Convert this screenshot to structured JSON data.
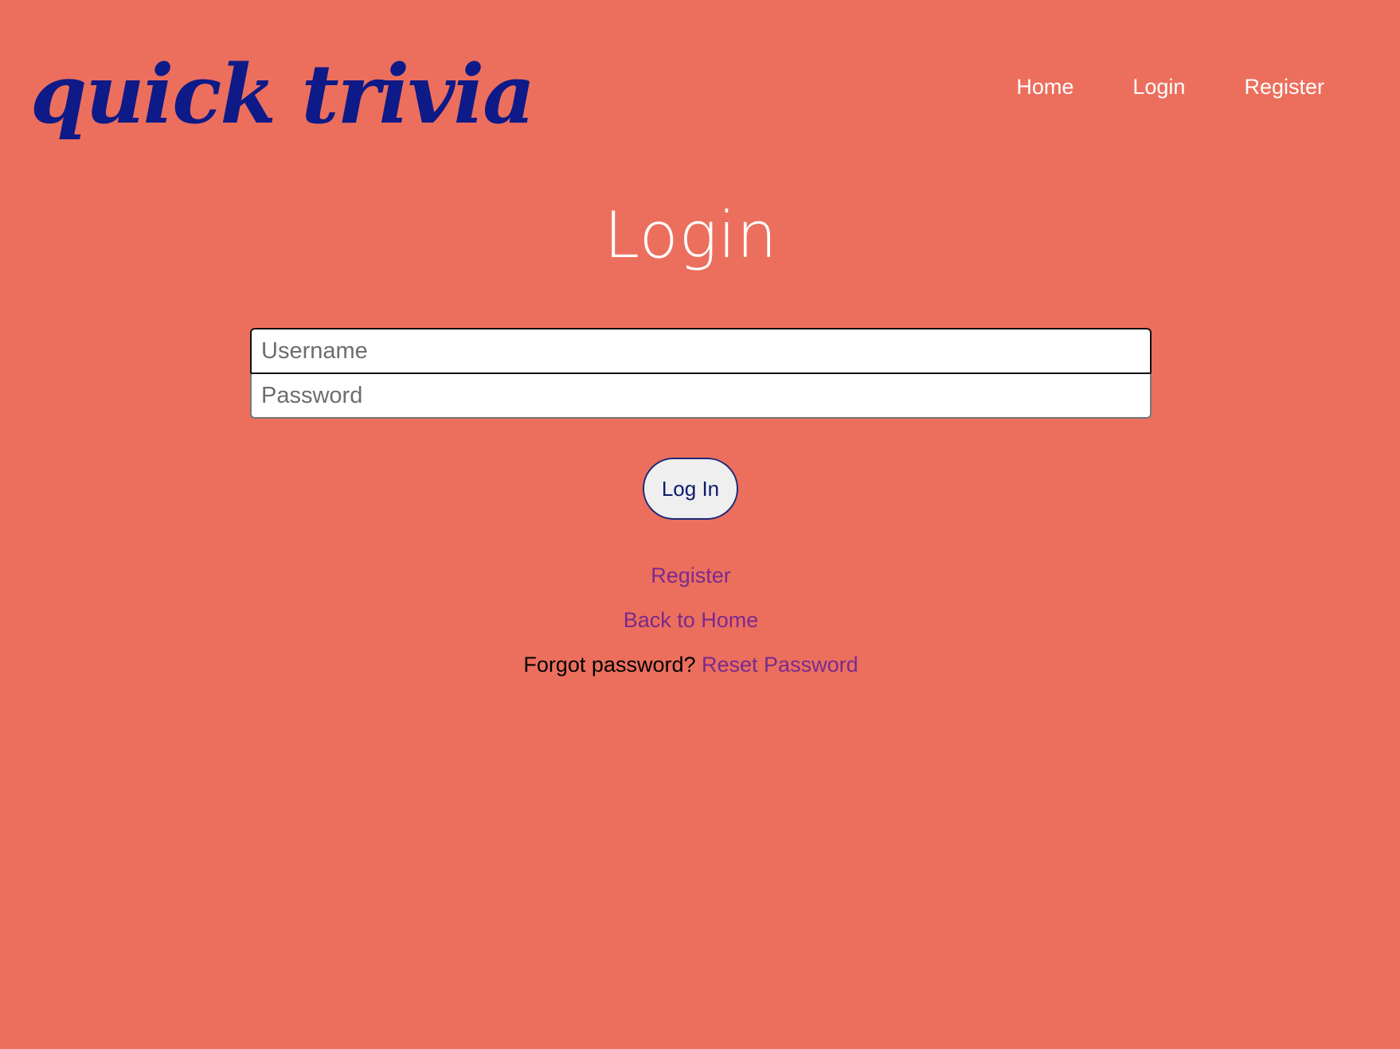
{
  "header": {
    "logo": "quick trivia",
    "nav": [
      {
        "label": "Home"
      },
      {
        "label": "Login"
      },
      {
        "label": "Register"
      }
    ]
  },
  "main": {
    "title": "Login",
    "username_placeholder": "Username",
    "password_placeholder": "Password",
    "submit_label": "Log In",
    "register_link": "Register",
    "home_link": "Back to Home",
    "forgot_text": "Forgot password?",
    "reset_link": "Reset Password"
  },
  "colors": {
    "background": "#ec6f5d",
    "logo": "#0e1a87",
    "link": "#7a2a8e"
  }
}
